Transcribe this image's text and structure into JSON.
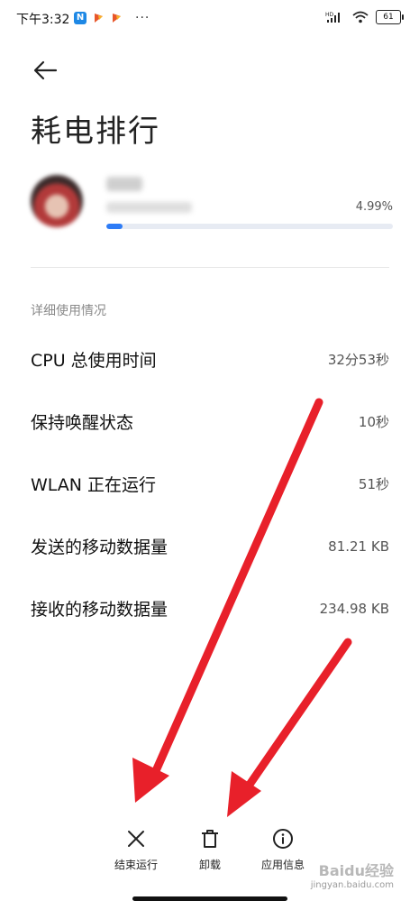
{
  "status_bar": {
    "time": "下午3:32",
    "app_badge": "N",
    "more": "···",
    "network": "HD",
    "battery": "61"
  },
  "header": {
    "title": "耗电排行"
  },
  "app_usage": {
    "percent": "4.99%",
    "bar_fraction": 0.0499
  },
  "details": {
    "section_label": "详细使用情况",
    "rows": [
      {
        "label": "CPU 总使用时间",
        "value": "32分53秒"
      },
      {
        "label": "保持唤醒状态",
        "value": "10秒"
      },
      {
        "label": "WLAN 正在运行",
        "value": "51秒"
      },
      {
        "label": "发送的移动数据量",
        "value": "81.21 KB"
      },
      {
        "label": "接收的移动数据量",
        "value": "234.98 KB"
      }
    ]
  },
  "actions": {
    "stop": "结束运行",
    "uninstall": "卸载",
    "app_info": "应用信息"
  },
  "watermark": {
    "brand": "Baidu经验",
    "url": "jingyan.baidu.com"
  },
  "colors": {
    "accent": "#2e7cf6",
    "annotation_arrow": "#e8202a"
  }
}
